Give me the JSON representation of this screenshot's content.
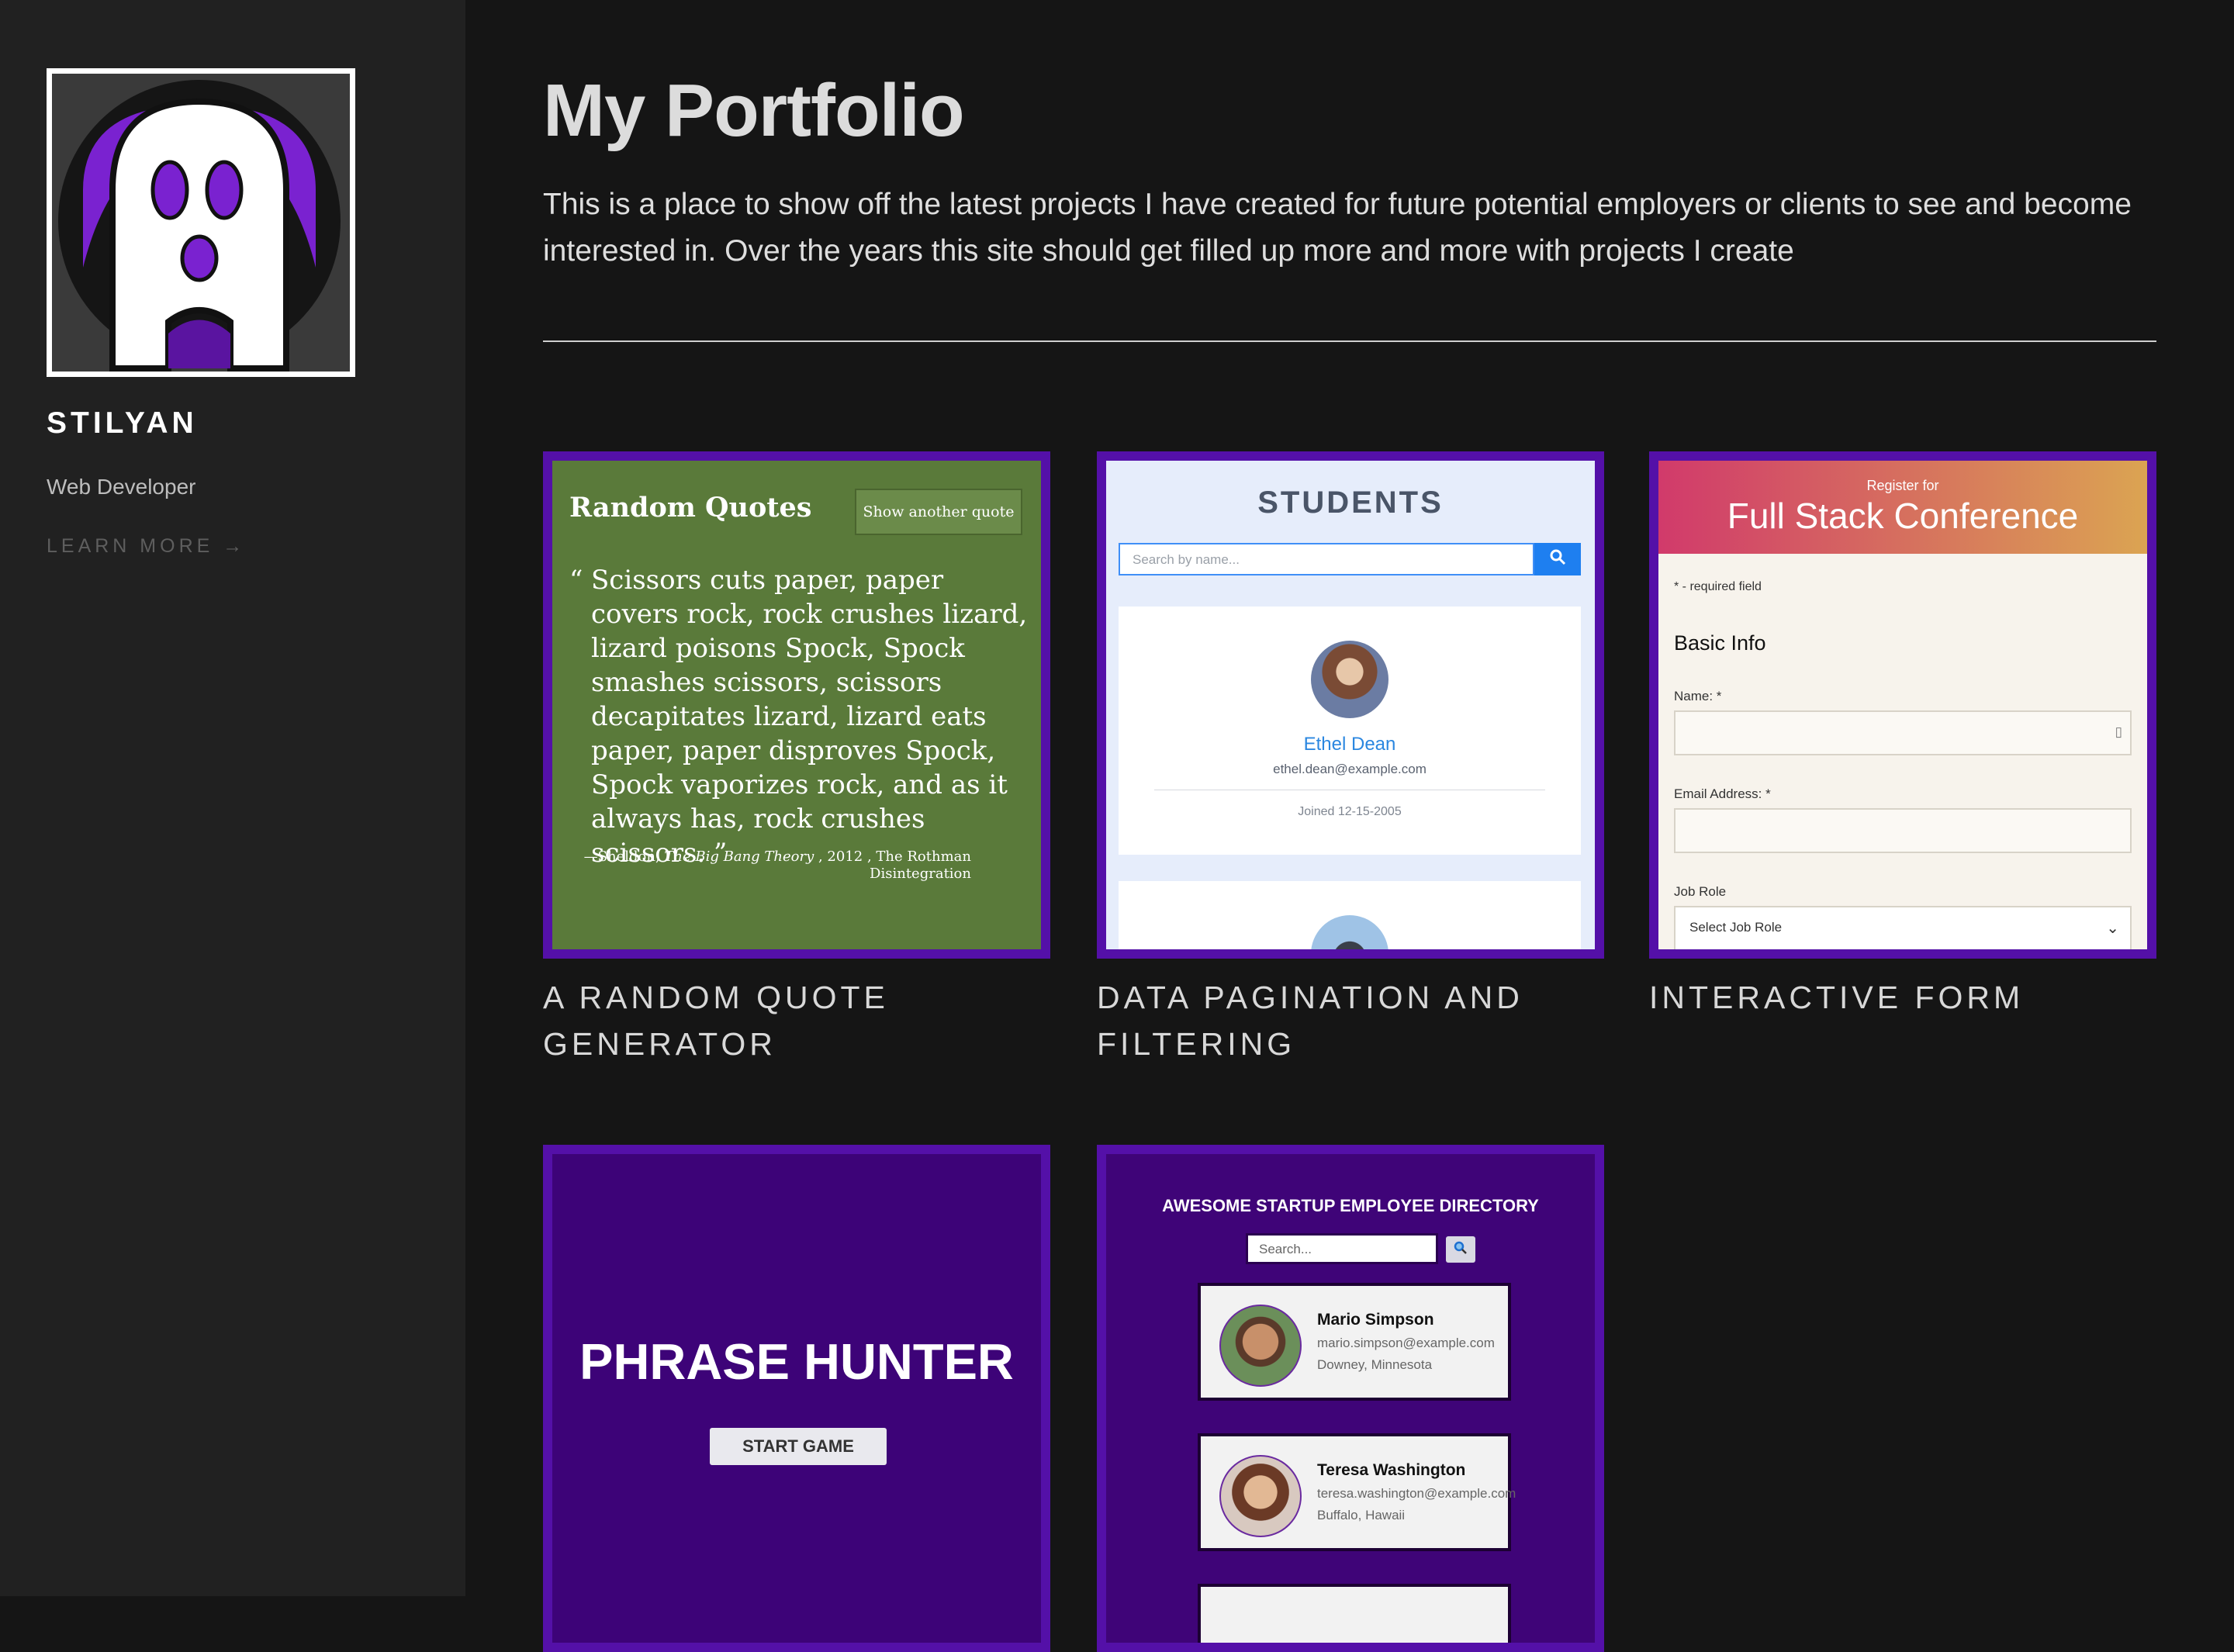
{
  "sidebar": {
    "name": "STILYAN",
    "role": "Web Developer",
    "learn_more": "LEARN MORE →"
  },
  "main": {
    "title": "My Portfolio",
    "intro": "This is a place to show off the latest projects I have created for future potential employers or clients to see and become interested in. Over the years this site should get filled up more and more with projects I create"
  },
  "projects": [
    {
      "caption": "A RANDOM QUOTE GENERATOR",
      "thumb": {
        "title": "Random Quotes",
        "button": "Show another quote",
        "open_quote": "“",
        "quote": "Scissors cuts paper, paper covers rock, rock crushes lizard, lizard poisons Spock, Spock smashes scissors, scissors decapitates lizard, lizard eats paper, paper disproves Spock, Spock vaporizes rock, and as it always has, rock crushes scissors. ”",
        "source_prefix": "—Sheldon, ",
        "source_work": "The Big Bang Theory",
        "source_rest": " , 2012 , The Rothman Disintegration"
      }
    },
    {
      "caption": "DATA PAGINATION AND FILTERING",
      "thumb": {
        "title": "STUDENTS",
        "search_placeholder": "Search by name...",
        "student_name": "Ethel Dean",
        "student_email": "ethel.dean@example.com",
        "joined": "Joined 12-15-2005"
      }
    },
    {
      "caption": "INTERACTIVE FORM",
      "thumb": {
        "register": "Register for",
        "conference": "Full Stack Conference",
        "required_note": "* - required field",
        "section": "Basic Info",
        "name_label": "Name: *",
        "email_label": "Email Address: *",
        "job_label": "Job Role",
        "job_select": "Select Job Role"
      }
    },
    {
      "caption": "",
      "thumb": {
        "title": "PHRASE HUNTER",
        "button": "START GAME"
      }
    },
    {
      "caption": "",
      "thumb": {
        "title": "AWESOME STARTUP EMPLOYEE DIRECTORY",
        "search_placeholder": "Search...",
        "employees": [
          {
            "name": "Mario Simpson",
            "email": "mario.simpson@example.com",
            "city": "Downey, Minnesota"
          },
          {
            "name": "Teresa Washington",
            "email": "teresa.washington@example.com",
            "city": "Buffalo, Hawaii"
          }
        ]
      }
    }
  ],
  "icons": {
    "search": "search-icon",
    "magnifier": "magnifier-icon",
    "chevron": "chevron-down-icon"
  },
  "colors": {
    "accent": "#5410a8",
    "background": "#151515",
    "sidebar": "#212121"
  }
}
